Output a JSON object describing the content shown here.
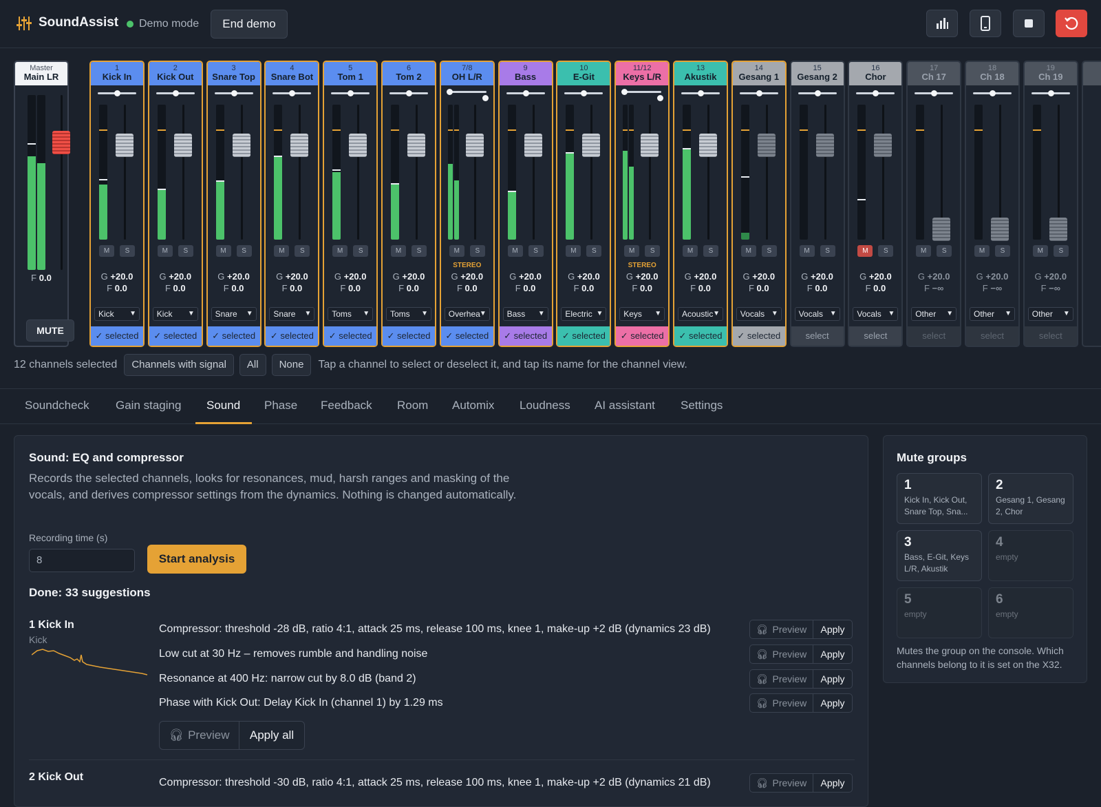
{
  "app": {
    "name": "SoundAssist",
    "demo_status": "Demo mode",
    "end_demo_label": "End demo"
  },
  "toolbar_icons": [
    "bar-chart-icon",
    "phone-icon",
    "stop-icon",
    "reset-icon"
  ],
  "master": {
    "label": "Master",
    "name": "Main LR",
    "fader": "0.0",
    "fader_prefix": "F",
    "mute_label": "MUTE"
  },
  "channels": [
    {
      "num": "1",
      "name": "Kick In",
      "color": "#5b8def",
      "group": "Kick",
      "selected": true,
      "stereo": false,
      "gain": "+20.0",
      "fader": "0.0",
      "level": 0.41,
      "peak": 0.45
    },
    {
      "num": "2",
      "name": "Kick Out",
      "color": "#5b8def",
      "group": "Kick",
      "selected": true,
      "stereo": false,
      "gain": "+20.0",
      "fader": "0.0",
      "level": 0.38,
      "peak": 0.38
    },
    {
      "num": "3",
      "name": "Snare Top",
      "color": "#5b8def",
      "group": "Snare",
      "selected": true,
      "stereo": false,
      "gain": "+20.0",
      "fader": "0.0",
      "level": 0.44,
      "peak": 0.44
    },
    {
      "num": "4",
      "name": "Snare Bot",
      "color": "#5b8def",
      "group": "Snare",
      "selected": true,
      "stereo": false,
      "gain": "+20.0",
      "fader": "0.0",
      "level": 0.62,
      "peak": 0.62
    },
    {
      "num": "5",
      "name": "Tom 1",
      "color": "#5b8def",
      "group": "Toms",
      "selected": true,
      "stereo": false,
      "gain": "+20.0",
      "fader": "0.0",
      "level": 0.5,
      "peak": 0.52
    },
    {
      "num": "6",
      "name": "Tom 2",
      "color": "#5b8def",
      "group": "Toms",
      "selected": true,
      "stereo": false,
      "gain": "+20.0",
      "fader": "0.0",
      "level": 0.42,
      "peak": 0.42
    },
    {
      "num": "7/8",
      "name": "OH L/R",
      "color": "#5b8def",
      "group": "Overhea",
      "selected": true,
      "stereo": true,
      "gain": "+20.0",
      "fader": "0.0",
      "level": 0.56,
      "peak": 0.56
    },
    {
      "num": "9",
      "name": "Bass",
      "color": "#a87be8",
      "group": "Bass",
      "selected": true,
      "stereo": false,
      "gain": "+20.0",
      "fader": "0.0",
      "level": 0.36,
      "peak": 0.36
    },
    {
      "num": "10",
      "name": "E-Git",
      "color": "#3bbfae",
      "group": "Electric",
      "selected": true,
      "stereo": false,
      "gain": "+20.0",
      "fader": "0.0",
      "level": 0.64,
      "peak": 0.65
    },
    {
      "num": "11/12",
      "name": "Keys L/R",
      "color": "#ec6fa6",
      "group": "Keys",
      "selected": true,
      "stereo": true,
      "gain": "+20.0",
      "fader": "0.0",
      "level": 0.66,
      "peak": 0.66
    },
    {
      "num": "13",
      "name": "Akustik",
      "color": "#3bbfae",
      "group": "Acoustic",
      "selected": true,
      "stereo": false,
      "gain": "+20.0",
      "fader": "0.0",
      "level": 0.68,
      "peak": 0.68
    },
    {
      "num": "14",
      "name": "Gesang 1",
      "color": "#a4a8ae",
      "group": "Vocals",
      "selected": true,
      "stereo": false,
      "gain": "+20.0",
      "fader": "0.0",
      "level": 0.05,
      "peak": 0.47
    },
    {
      "num": "15",
      "name": "Gesang 2",
      "color": "#a4a8ae",
      "group": "Vocals",
      "selected": false,
      "stereo": false,
      "gain": "+20.0",
      "fader": "0.0",
      "level": 0,
      "peak": 0
    },
    {
      "num": "16",
      "name": "Chor",
      "color": "#a4a8ae",
      "group": "Vocals",
      "selected": false,
      "muted": true,
      "stereo": false,
      "gain": "+20.0",
      "fader": "0.0",
      "level": 0,
      "peak": 0.3
    },
    {
      "num": "17",
      "name": "Ch 17",
      "color": "#4d545e",
      "group": "Other",
      "selected": false,
      "faint": true,
      "stereo": false,
      "gain": "+20.0",
      "fader": "−∞",
      "level": 0,
      "peak": 0
    },
    {
      "num": "18",
      "name": "Ch 18",
      "color": "#4d545e",
      "group": "Other",
      "selected": false,
      "faint": true,
      "stereo": false,
      "gain": "+20.0",
      "fader": "−∞",
      "level": 0,
      "peak": 0
    },
    {
      "num": "19",
      "name": "Ch 19",
      "color": "#4d545e",
      "group": "Other",
      "selected": false,
      "faint": true,
      "stereo": false,
      "gain": "+20.0",
      "fader": "−∞",
      "level": 0,
      "peak": 0
    }
  ],
  "strip_labels": {
    "mute": "M",
    "solo": "S",
    "gain_prefix": "G",
    "fader_prefix": "F",
    "stereo": "STEREO",
    "selected": "✓ selected",
    "select": "select"
  },
  "selection": {
    "count_text": "12 channels selected",
    "chips": [
      "Channels with signal",
      "All",
      "None"
    ],
    "hint": "Tap a channel to select or deselect it, and tap its name for the channel view."
  },
  "tabs": [
    "Soundcheck",
    "Gain staging",
    "Sound",
    "Phase",
    "Feedback",
    "Room",
    "Automix",
    "Loudness",
    "AI assistant",
    "Settings"
  ],
  "active_tab": "Sound",
  "sound": {
    "title": "Sound: EQ and compressor",
    "description": "Records the selected channels, looks for resonances, mud, harsh ranges and masking of the vocals, and derives compressor settings from the dynamics. Nothing is changed automatically.",
    "recording_label": "Recording time (s)",
    "recording_value": "8",
    "start_label": "Start analysis",
    "done_text": "Done: 33 suggestions",
    "preview_label": "Preview",
    "apply_label": "Apply",
    "apply_all_label": "Apply all",
    "results": [
      {
        "name": "1 Kick In",
        "type": "Kick",
        "suggestions": [
          "Compressor: threshold -28 dB, ratio 4:1, attack 25 ms, release 100 ms, knee 1, make-up +2 dB (dynamics 23 dB)",
          "Low cut at 30 Hz – removes rumble and handling noise",
          "Resonance at 400 Hz: narrow cut by 8.0 dB (band 2)",
          "Phase with Kick Out: Delay Kick In (channel 1) by 1.29 ms"
        ]
      },
      {
        "name": "2 Kick Out",
        "type": "",
        "suggestions": [
          "Compressor: threshold -30 dB, ratio 4:1, attack 25 ms, release 100 ms, knee 1, make-up +2 dB (dynamics 21 dB)"
        ]
      }
    ]
  },
  "mute_groups": {
    "title": "Mute groups",
    "groups": [
      {
        "n": "1",
        "members": "Kick In, Kick Out, Snare Top, Sna...",
        "empty": false
      },
      {
        "n": "2",
        "members": "Gesang 1, Gesang 2, Chor",
        "empty": false
      },
      {
        "n": "3",
        "members": "Bass, E-Git, Keys L/R, Akustik",
        "empty": false
      },
      {
        "n": "4",
        "members": "empty",
        "empty": true
      },
      {
        "n": "5",
        "members": "empty",
        "empty": true
      },
      {
        "n": "6",
        "members": "empty",
        "empty": true
      }
    ],
    "note": "Mutes the group on the console. Which channels belong to it is set on the X32."
  }
}
